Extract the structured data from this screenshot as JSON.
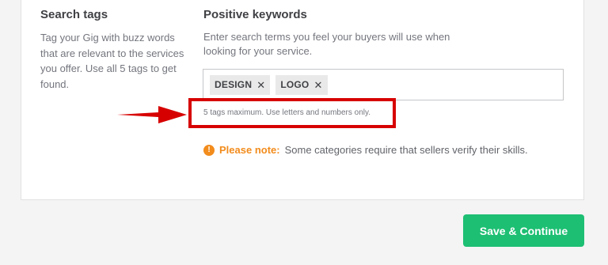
{
  "search_tags": {
    "title": "Search tags",
    "description": "Tag your Gig with buzz words that are relevant to the services you offer. Use all 5 tags to get found."
  },
  "positive_keywords": {
    "title": "Positive keywords",
    "description": "Enter search terms you feel your buyers will use when looking for your service.",
    "tags": [
      {
        "label": "DESIGN",
        "remove_icon": "close-icon"
      },
      {
        "label": "LOGO",
        "remove_icon": "close-icon"
      }
    ],
    "hint": "5 tags maximum. Use letters and numbers only."
  },
  "note": {
    "icon": "info-icon",
    "label": "Please note:",
    "text": "Some categories require that sellers verify their skills."
  },
  "save_button": {
    "label": "Save & Continue"
  },
  "colors": {
    "accent_green": "#1dbf73",
    "annotation_red": "#d70000",
    "note_orange": "#f28c1c"
  }
}
